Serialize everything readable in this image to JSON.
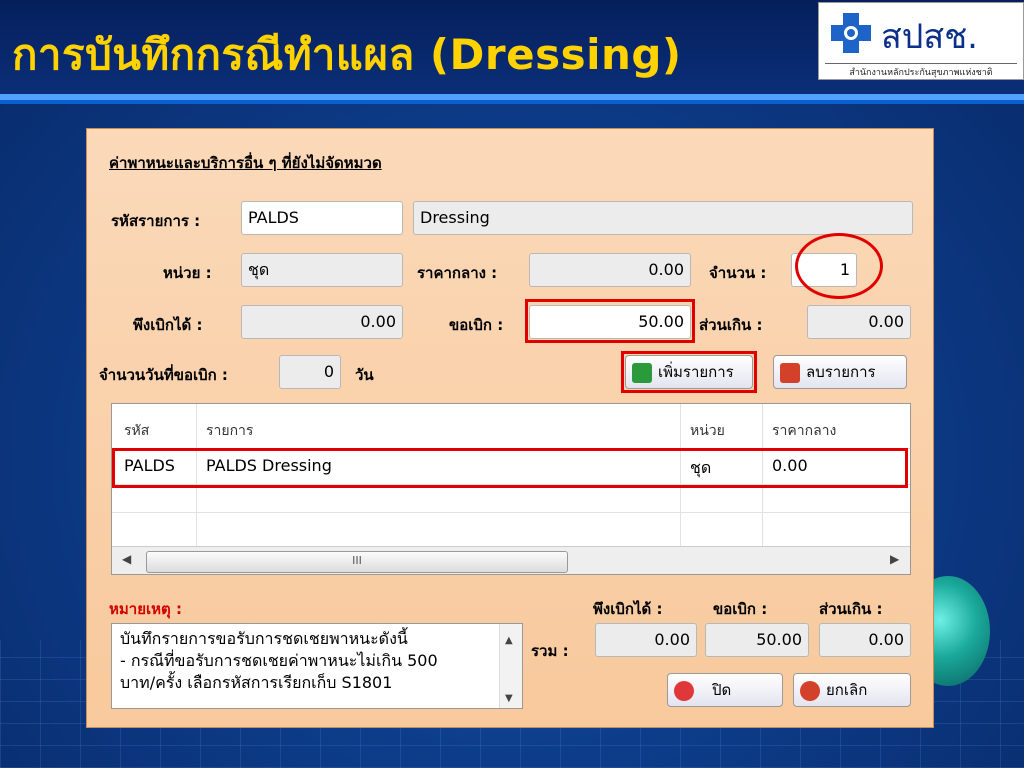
{
  "slide": {
    "title": "การบันทึกกรณีทำแผล (Dressing)",
    "logo": {
      "text": "สปสช.",
      "subtitle": "สำนักงานหลักประกันสุขภาพแห่งชาติ"
    }
  },
  "dialog": {
    "section_title": "ค่าพาหนะและบริการอื่น ๆ ที่ยังไม่จัดหมวด",
    "item_code": {
      "label": "รหัสรายการ :",
      "value": "PALDS",
      "name_value": "Dressing"
    },
    "unit": {
      "label": "หน่วย :",
      "value": "ชุด"
    },
    "center_price": {
      "label": "ราคากลาง :",
      "value": "0.00"
    },
    "quantity": {
      "label": "จำนวน :",
      "value": "1"
    },
    "claimable": {
      "label": "พึงเบิกได้ :",
      "value": "0.00"
    },
    "requested": {
      "label": "ขอเบิก :",
      "value": "50.00"
    },
    "excess": {
      "label": "ส่วนเกิน :",
      "value": "0.00"
    },
    "days": {
      "label": "จำนวนวันที่ขอเบิก :",
      "value": "0",
      "unit": "วัน"
    },
    "buttons": {
      "add": "เพิ่มรายการ",
      "delete": "ลบรายการ",
      "close": "ปิด",
      "cancel": "ยกเลิก"
    },
    "table": {
      "columns": [
        "รหัส",
        "รายการ",
        "หน่วย",
        "ราคากลาง"
      ],
      "rows": [
        {
          "code": "PALDS",
          "item": "PALDS Dressing",
          "unit": "ชุด",
          "price": "0.00"
        }
      ],
      "scroll_thumb": "III"
    },
    "remark": {
      "label": "หมายเหตุ :",
      "lines": [
        "บันทึกรายการขอรับการชดเชยพาหนะดังนี้",
        "- กรณีที่ขอรับการชดเชยค่าพาหนะไม่เกิน 500",
        "บาท/ครั้ง เลือกรหัสการเรียกเก็บ S1801"
      ]
    },
    "totals": {
      "label": "รวม :",
      "claimable_label": "พึงเบิกได้ :",
      "requested_label": "ขอเบิก :",
      "excess_label": "ส่วนเกิน :",
      "claimable": "0.00",
      "requested": "50.00",
      "excess": "0.00"
    }
  },
  "colors": {
    "title": "#ffd200",
    "dialog_bg": "#f8c99c",
    "highlight": "#e00000",
    "label_red": "#d40000"
  }
}
